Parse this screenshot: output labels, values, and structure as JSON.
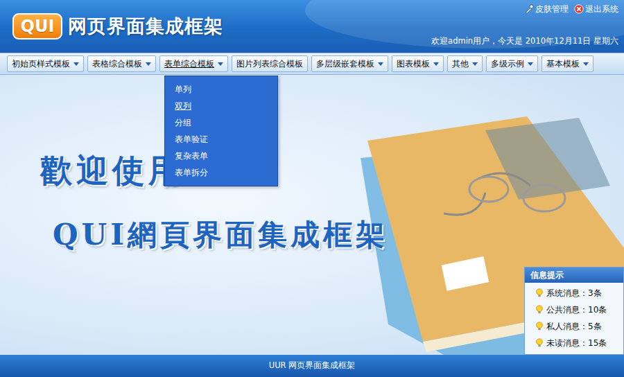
{
  "header": {
    "logo": "QUI",
    "title": "网页界面集成框架",
    "links": [
      {
        "label": "皮肤管理"
      },
      {
        "label": "退出系统"
      }
    ],
    "welcome": "欢迎admin用户，今天是 2010年12月11日 星期六"
  },
  "menu": [
    {
      "label": "初始页样式模板",
      "has_menu": true,
      "selected": false
    },
    {
      "label": "表格综合模板",
      "has_menu": true,
      "selected": false
    },
    {
      "label": "表单综合模板",
      "has_menu": true,
      "selected": true
    },
    {
      "label": "图片列表综合模板",
      "has_menu": false,
      "selected": false
    },
    {
      "label": "多层级嵌套模板",
      "has_menu": true,
      "selected": false
    },
    {
      "label": "图表模板",
      "has_menu": true,
      "selected": false
    },
    {
      "label": "其他",
      "has_menu": true,
      "selected": false
    },
    {
      "label": "多级示例",
      "has_menu": true,
      "selected": false
    },
    {
      "label": "基本模板",
      "has_menu": true,
      "selected": false
    }
  ],
  "dropdown": {
    "items": [
      {
        "label": "单列",
        "selected": false
      },
      {
        "label": "双列",
        "selected": true
      },
      {
        "label": "分组",
        "selected": false
      },
      {
        "label": "表单验证",
        "selected": false
      },
      {
        "label": "复杂表单",
        "selected": false
      },
      {
        "label": "表单拆分",
        "selected": false
      }
    ]
  },
  "banner": {
    "lines": [
      "歡迎使用",
      "QUI網頁界面集成框架"
    ]
  },
  "info_panel": {
    "title": "信息提示",
    "items": [
      {
        "label": "系统消息：3条"
      },
      {
        "label": "公共消息：10条"
      },
      {
        "label": "私人消息：5条"
      },
      {
        "label": "未读消息：15条"
      }
    ]
  },
  "footer": "UUR 网页界面集成框架"
}
